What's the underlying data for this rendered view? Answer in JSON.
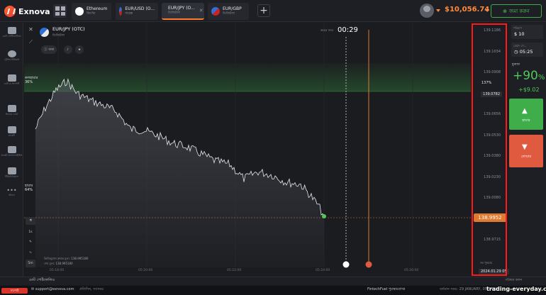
{
  "brand": {
    "name": "Exnova"
  },
  "tabs": [
    {
      "title": "Ethereum",
      "subtitle": "ক্রিপ্টো",
      "icon": "ethereum-icon"
    },
    {
      "title": "EUR/USD (O...",
      "subtitle": "ফরেক্স",
      "icon": "eurusd-flag-icon"
    },
    {
      "title": "EUR/JPY (O...",
      "subtitle": "ডিজিটাল",
      "icon": "eurjpy-flag-icon",
      "active": true
    },
    {
      "title": "EUR/GBP",
      "subtitle": "ডিজিটাল",
      "icon": "eurgbp-flag-icon"
    }
  ],
  "account": {
    "balance": "$10,056.74",
    "deposit_label": "জমা করুন"
  },
  "sidebar": [
    {
      "label": "মোট পোর্টফোলিও",
      "icon": "portfolio-icon"
    },
    {
      "label": "ট্রেডিং ইতিহাস",
      "icon": "history-icon"
    },
    {
      "label": "চ্যাট ও সাপোর্ট",
      "icon": "chat-icon"
    },
    {
      "label": "লিডার বোর্ড",
      "icon": "leaderboard-icon"
    },
    {
      "label": "মার্কেট",
      "icon": "market-icon"
    },
    {
      "label": "মার্কেট অ্যানালাইসিস",
      "icon": "analysis-icon"
    },
    {
      "label": "টিউটোরিয়াল",
      "icon": "tutorial-icon"
    },
    {
      "label": "আরও",
      "icon": "more-icon"
    }
  ],
  "asset": {
    "pair": "EUR/JPY (OTC)",
    "type": "ডিজিটাল",
    "info_label": "তথ্য"
  },
  "timer": {
    "label": "ক্রয়ের সময়",
    "value": "00:29"
  },
  "sentiment": {
    "up_label": "কলহায়ার",
    "up_pct": "36%",
    "down_label": "হায়ার",
    "down_pct": "64%"
  },
  "price_axis": {
    "labels": [
      "139.1186",
      "139.1034",
      "139.0908",
      "139.0782",
      "139.0656",
      "139.0530",
      "139.0380",
      "139.0230",
      "139.0080",
      "138.9841",
      "138.9715"
    ],
    "current_price": "138.9952",
    "highlight": "139.0782",
    "pct_label": "137%",
    "now_label": "সব পুনরায়",
    "date": "2024.01.29 05"
  },
  "chart_data": {
    "type": "line",
    "x_ticks": [
      "05:18:00",
      "05:20:00",
      "05:22:00",
      "05:24:00",
      "05:26:00"
    ],
    "ylim": [
      138.9715,
      139.1186
    ],
    "current_price": 138.9952
  },
  "legend": {
    "line1": "ভিজিয়ুয়াল ক্রয়ার মূল্য: 138.995180",
    "line2": "শেষ মূল্য: 138.995180"
  },
  "toolbar_left": {
    "timeframe_1": "1s",
    "timeframe_2": "5m"
  },
  "trade_panel": {
    "time_label": "পরিমাণ",
    "time_value": "10",
    "time_currency": "$",
    "expiry_label": "মেয়াদ শে...",
    "expiry_value": "05:25",
    "payout_label": "মুনাফা",
    "payout_pct": "+90",
    "payout_amount": "+$9.02",
    "up_button": "হায়ার",
    "down_button": "লোয়ার"
  },
  "bottom": {
    "left": "মোট পোর্টফোলিও",
    "right": "পরিষ্কার করুন"
  },
  "footer": {
    "support_label": "সাপোর্ট",
    "email": "support@exnova.com",
    "hours": "প্রতিদিন, সবসময়",
    "promo": "FintechFuel পুরস্কারপ্রাপ্ত",
    "datetime": "বর্তমান সময়: 29 JANUARY, 05:24:01",
    "watermark": "trading-everyday.com"
  }
}
